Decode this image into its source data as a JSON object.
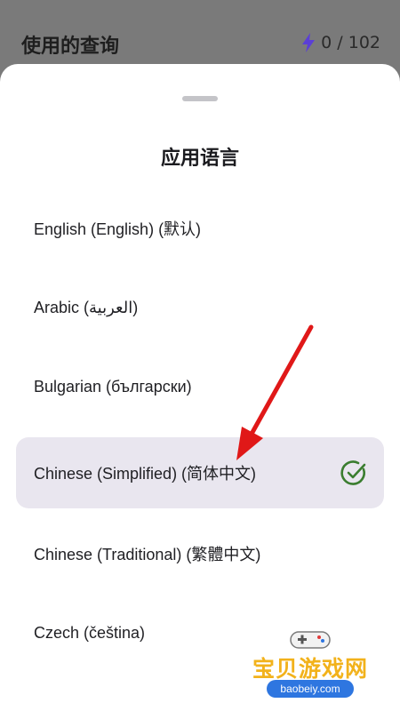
{
  "topbar": {
    "title": "使用的查询",
    "quota": "0 / 102",
    "bolt_icon": "lightning-icon",
    "bolt_color": "#5b3fd6"
  },
  "sheet": {
    "title": "应用语言",
    "items": [
      {
        "label": "English (English) (默认)",
        "selected": false
      },
      {
        "label": "Arabic (العربية)",
        "selected": false
      },
      {
        "label": "Bulgarian (български)",
        "selected": false
      },
      {
        "label": "Chinese (Simplified) (简体中文)",
        "selected": true
      },
      {
        "label": "Chinese (Traditional) (繁體中文)",
        "selected": false
      },
      {
        "label": "Czech (čeština)",
        "selected": false
      }
    ],
    "check_icon": "check-circle-icon",
    "check_color": "#3a7d2f",
    "selected_bg": "#e9e6ef"
  },
  "annotation": {
    "arrow_color": "#e01818"
  },
  "watermark": {
    "text": "宝贝游戏网",
    "url": "baobeiy.com"
  }
}
